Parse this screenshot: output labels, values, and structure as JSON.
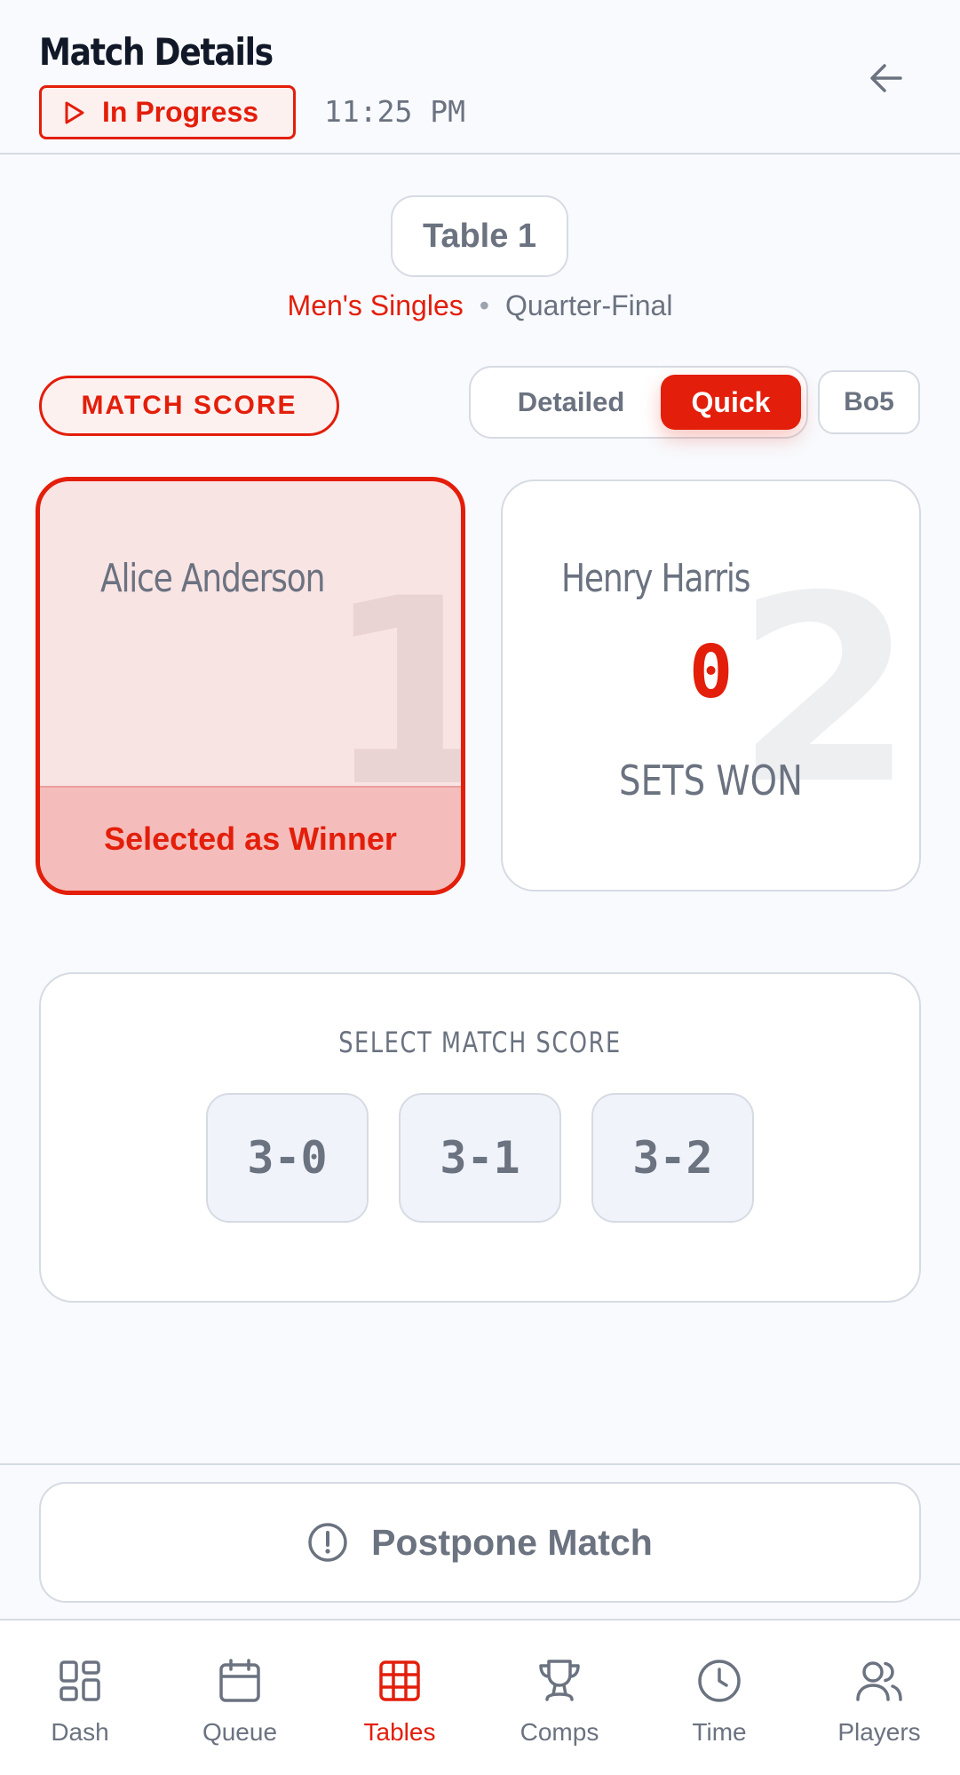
{
  "header": {
    "title": "Match Details",
    "status": "In Progress",
    "time": "11:25 PM"
  },
  "match": {
    "table": "Table 1",
    "category": "Men's Singles",
    "separator": "•",
    "round": "Quarter-Final"
  },
  "score_mode": {
    "badge": "MATCH SCORE",
    "options": [
      "Detailed",
      "Quick"
    ],
    "selected": "Quick",
    "format": "Bo5"
  },
  "players": [
    {
      "name": "Alice Anderson",
      "seed": "1",
      "winner_label": "Selected as Winner",
      "selected": true
    },
    {
      "name": "Henry Harris",
      "seed": "2",
      "sets_won": "0",
      "sets_label": "SETS WON",
      "selected": false
    }
  ],
  "score_selector": {
    "title": "SELECT MATCH SCORE",
    "options": [
      "3-0",
      "3-1",
      "3-2"
    ]
  },
  "actions": {
    "postpone": "Postpone Match"
  },
  "nav": {
    "items": [
      {
        "label": "Dash",
        "icon": "dashboard-icon"
      },
      {
        "label": "Queue",
        "icon": "calendar-icon"
      },
      {
        "label": "Tables",
        "icon": "grid-icon"
      },
      {
        "label": "Comps",
        "icon": "trophy-icon"
      },
      {
        "label": "Time",
        "icon": "clock-icon"
      },
      {
        "label": "Players",
        "icon": "users-icon"
      }
    ],
    "active": "Tables"
  },
  "colors": {
    "accent": "#e31e0a",
    "muted": "#6b7280",
    "border": "#d6dbe3",
    "background": "#f8fafd"
  }
}
